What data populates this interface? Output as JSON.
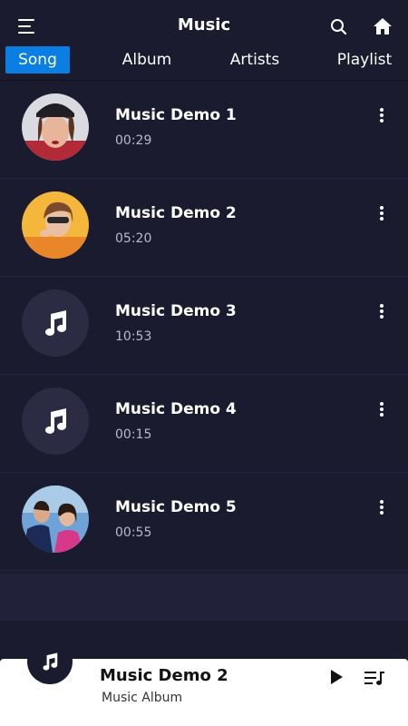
{
  "header": {
    "title": "Music",
    "menu_icon": "hamburger-icon",
    "search_icon": "search-icon",
    "home_icon": "home-icon"
  },
  "tabs": [
    {
      "label": "Song",
      "active": true
    },
    {
      "label": "Album",
      "active": false
    },
    {
      "label": "Artists",
      "active": false
    },
    {
      "label": "Playlist",
      "active": false
    }
  ],
  "songs": [
    {
      "title": "Music Demo 1",
      "duration": "00:29",
      "art": "photo"
    },
    {
      "title": "Music Demo 2",
      "duration": "05:20",
      "art": "photo"
    },
    {
      "title": "Music Demo 3",
      "duration": "10:53",
      "art": "music-note-icon"
    },
    {
      "title": "Music Demo 4",
      "duration": "00:15",
      "art": "music-note-icon"
    },
    {
      "title": "Music Demo 5",
      "duration": "00:55",
      "art": "photo"
    }
  ],
  "player": {
    "title": "Music Demo 2",
    "subtitle": "Music Album",
    "play_icon": "play-icon",
    "queue_icon": "playlist-icon"
  },
  "colors": {
    "background": "#1b1b2f",
    "accent": "#0b7ee4",
    "player_bg": "#ffffff"
  }
}
